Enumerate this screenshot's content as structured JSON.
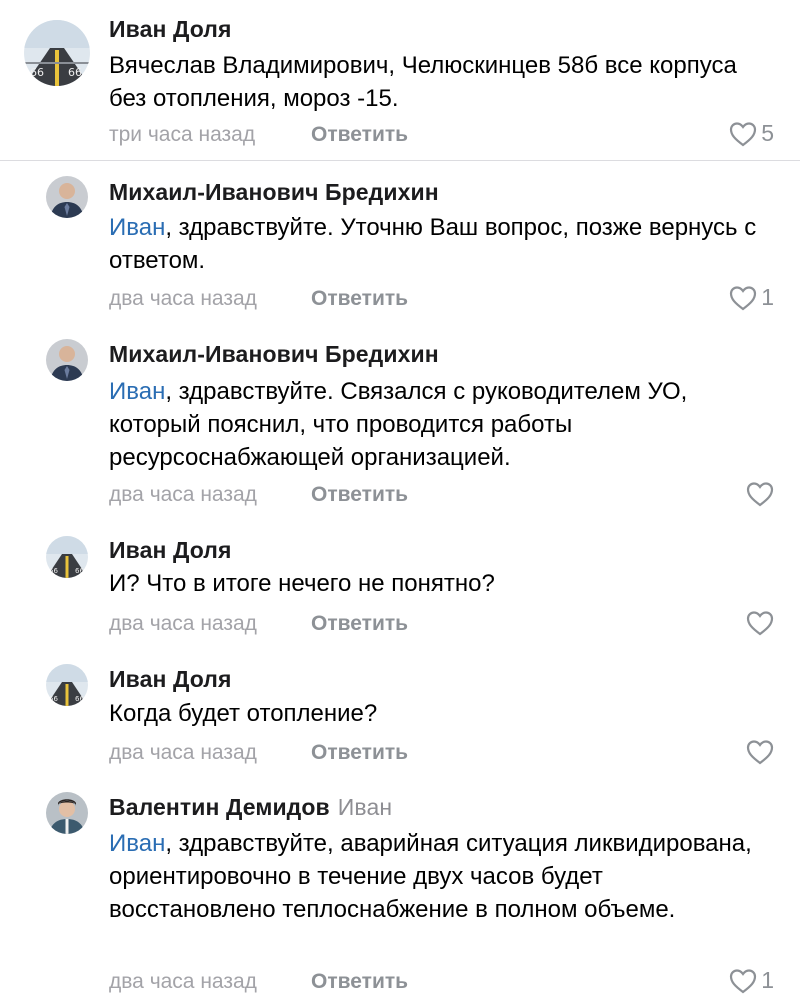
{
  "comments": [
    {
      "author": "Иван Доля",
      "reply_to": "",
      "mention": "",
      "text": "Вячеслав Владимирович, Челюскинцев 58б все корпуса без отопления, мороз -15.",
      "time": "три часа назад",
      "reply_label": "Ответить",
      "likes": "5",
      "avatar_icon": "road-avatar-icon"
    },
    {
      "author": "Михаил-Иванович Бредихин",
      "reply_to": "",
      "mention": "Иван",
      "text": ", здравствуйте. Уточню Ваш вопрос, позже вернусь с ответом.",
      "time": "два часа назад",
      "reply_label": "Ответить",
      "likes": "1",
      "avatar_icon": "man-in-suit-avatar-icon"
    },
    {
      "author": "Михаил-Иванович Бредихин",
      "reply_to": "",
      "mention": "Иван",
      "text": ", здравствуйте. Связался с руководителем УО, который пояснил, что проводится работы ресурсоснабжающей организацией.",
      "time": "два часа назад",
      "reply_label": "Ответить",
      "likes": "",
      "avatar_icon": "man-in-suit-avatar-icon"
    },
    {
      "author": "Иван Доля",
      "reply_to": "",
      "mention": "",
      "text": "И? Что в итоге нечего не понятно?",
      "time": "два часа назад",
      "reply_label": "Ответить",
      "likes": "",
      "avatar_icon": "road-avatar-icon"
    },
    {
      "author": "Иван Доля",
      "reply_to": "",
      "mention": "",
      "text": "Когда будет отопление?",
      "time": "два часа назад",
      "reply_label": "Ответить",
      "likes": "",
      "avatar_icon": "road-avatar-icon"
    },
    {
      "author": "Валентин Демидов",
      "reply_to": "Иван",
      "mention": "Иван",
      "text": ", здравствуйте, аварийная ситуация ликвидирована, ориентировочно в течение двух часов будет восстановлено теплоснабжение в полном объеме.",
      "time": "два часа назад",
      "reply_label": "Ответить",
      "likes": "1",
      "avatar_icon": "man-portrait-avatar-icon"
    }
  ],
  "colors": {
    "mention": "#2a6db3",
    "meta": "#a3a3a8",
    "action": "#8d9196"
  }
}
